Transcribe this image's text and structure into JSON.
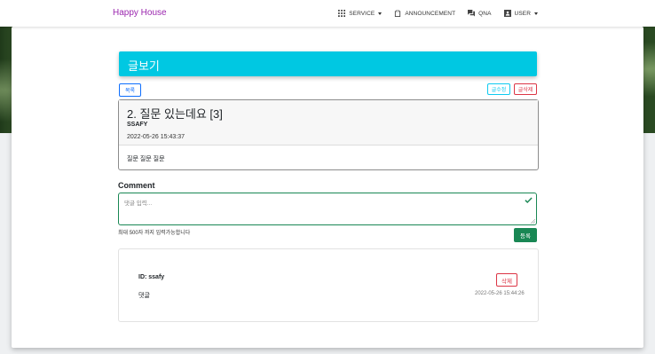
{
  "navbar": {
    "brand": "Happy House",
    "items": [
      {
        "label": "SERVICE",
        "icon": "grid-icon",
        "dropdown": true
      },
      {
        "label": "ANNOUNCEMENT",
        "icon": "clipboard-icon",
        "dropdown": false
      },
      {
        "label": "QNA",
        "icon": "chat-icon",
        "dropdown": false
      },
      {
        "label": "USER",
        "icon": "user-card-icon",
        "dropdown": true
      }
    ]
  },
  "page": {
    "title": "글보기",
    "list_button": "목록",
    "edit_button": "글수정",
    "delete_button": "글삭제"
  },
  "article": {
    "title": "2. 질문 있는데요 [3]",
    "author": "SSAFY",
    "date": "2022-05-26 15:43:37",
    "content": "질문 질문 질문"
  },
  "comment_form": {
    "label": "Comment",
    "placeholder": "댓글 입력...",
    "helper": "최대 500자 까지 입력가능합니다",
    "submit_button": "등록"
  },
  "comments": [
    {
      "id_label": "ID: ssafy",
      "text": "댓글",
      "date": "2022-05-26 15:44:26",
      "delete_button": "삭제"
    }
  ],
  "colors": {
    "brand": "#9b27af",
    "header": "#00c8e2",
    "success": "#198754",
    "danger": "#dc3545",
    "primary": "#0d6efd"
  }
}
